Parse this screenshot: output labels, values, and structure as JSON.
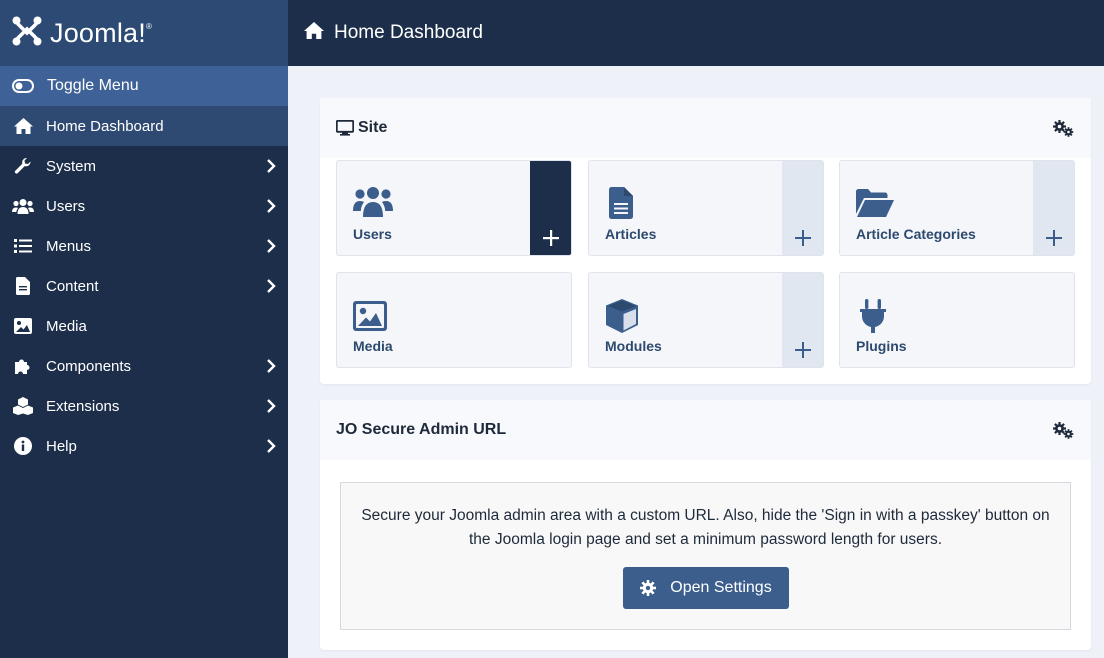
{
  "app": {
    "brand": "Joomla!",
    "brand_main": "Joomla",
    "brand_mark": "®"
  },
  "header": {
    "title": "Home Dashboard",
    "icon": "home-icon"
  },
  "sidebar": {
    "items": [
      {
        "label": "Toggle Menu",
        "icon": "toggle-icon"
      },
      {
        "label": "Home Dashboard",
        "icon": "home-icon"
      },
      {
        "label": "System",
        "icon": "wrench-icon"
      },
      {
        "label": "Users",
        "icon": "users-icon"
      },
      {
        "label": "Menus",
        "icon": "list-icon"
      },
      {
        "label": "Content",
        "icon": "file-icon"
      },
      {
        "label": "Media",
        "icon": "image-icon"
      },
      {
        "label": "Components",
        "icon": "puzzle-icon"
      },
      {
        "label": "Extensions",
        "icon": "cubes-icon"
      },
      {
        "label": "Help",
        "icon": "info-icon"
      }
    ]
  },
  "site_card": {
    "title": "Site",
    "tiles": [
      {
        "label": "Users",
        "icon": "users-icon"
      },
      {
        "label": "Articles",
        "icon": "file-icon"
      },
      {
        "label": "Article Categories",
        "icon": "folder-icon"
      },
      {
        "label": "Media",
        "icon": "image-icon"
      },
      {
        "label": "Modules",
        "icon": "cube-icon"
      },
      {
        "label": "Plugins",
        "icon": "plug-icon"
      }
    ],
    "add_symbol": "+"
  },
  "secure_card": {
    "title": "JO Secure Admin URL",
    "description": "Secure your Joomla admin area with a custom URL. Also, hide the 'Sign in with a passkey' button on the Joomla login page and set a minimum password length for users.",
    "button_label": "Open Settings"
  },
  "colors": {
    "sidebar_bg": "#1c2e49",
    "brand_bg": "#2c4a73",
    "toggle_bg": "#3e6297",
    "active_bg": "#2e4a72",
    "accent": "#3b5e8c",
    "tile_text": "#2d4a6e"
  }
}
